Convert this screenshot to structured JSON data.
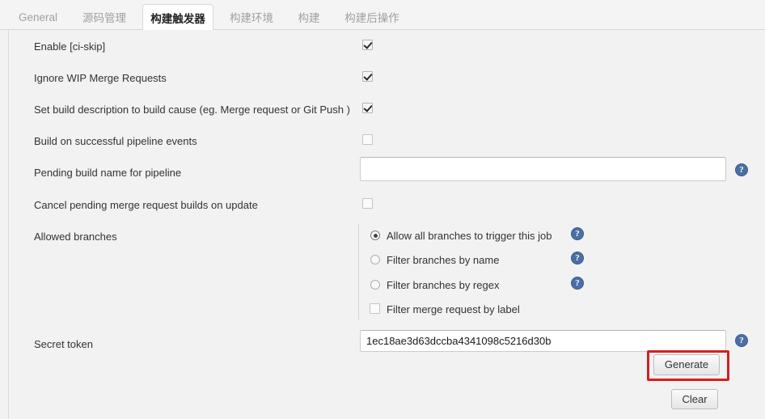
{
  "tabs": [
    {
      "label": "General",
      "active": false
    },
    {
      "label": "源码管理",
      "active": false
    },
    {
      "label": "构建触发器",
      "active": true
    },
    {
      "label": "构建环境",
      "active": false
    },
    {
      "label": "构建",
      "active": false
    },
    {
      "label": "构建后操作",
      "active": false
    }
  ],
  "form": {
    "enable_ci_skip": {
      "label": "Enable [ci-skip]",
      "checked": true
    },
    "ignore_wip": {
      "label": "Ignore WIP Merge Requests",
      "checked": true
    },
    "set_build_description": {
      "label": "Set build description to build cause (eg. Merge request or Git Push )",
      "checked": true
    },
    "build_on_pipeline": {
      "label": "Build on successful pipeline events",
      "checked": false
    },
    "pending_build_name": {
      "label": "Pending build name for pipeline",
      "value": "",
      "placeholder": ""
    },
    "cancel_pending": {
      "label": "Cancel pending merge request builds on update",
      "checked": false
    },
    "allowed_branches": {
      "label": "Allowed branches",
      "options": [
        {
          "label": "Allow all branches to trigger this job",
          "type": "radio",
          "selected": true,
          "help": true
        },
        {
          "label": "Filter branches by name",
          "type": "radio",
          "selected": false,
          "help": true
        },
        {
          "label": "Filter branches by regex",
          "type": "radio",
          "selected": false,
          "help": true
        },
        {
          "label": "Filter merge request by label",
          "type": "checkbox",
          "selected": false,
          "help": false
        }
      ]
    },
    "secret_token": {
      "label": "Secret token",
      "value": "1ec18ae3d63dccba4341098c5216d30b",
      "placeholder": ""
    },
    "generate_button": "Generate",
    "clear_button": "Clear"
  },
  "icons": {
    "help": "?"
  },
  "colors": {
    "highlight": "#d81f1f",
    "help_icon": "#4a6fa5",
    "page_bg": "#f2f2f2",
    "tabbar_bg": "#f4f4f4",
    "active_tab_bg": "#ffffff"
  }
}
